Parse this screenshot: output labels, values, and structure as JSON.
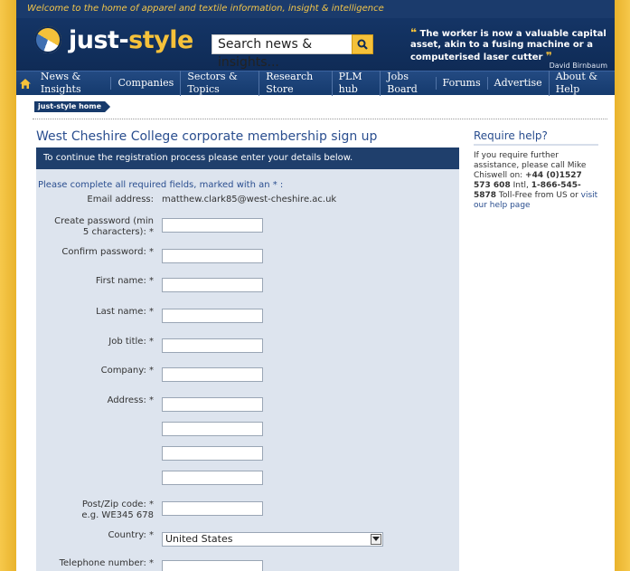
{
  "header": {
    "welcome": "Welcome to the home of apparel and textile information, insight & intelligence",
    "logo_text_main": "just-",
    "logo_text_accent": "style",
    "search_placeholder": "Search news & insights...",
    "quote_open": "❝",
    "quote_close": "❞",
    "quote_text": "The worker is now a valuable capital asset, akin to a fusing machine or a computerised laser cutter",
    "quote_author": "David Birnbaum"
  },
  "nav": {
    "home_icon": "home-icon",
    "items": [
      "News & Insights",
      "Companies",
      "Sectors & Topics",
      "Research Store",
      "PLM hub",
      "Jobs Board",
      "Forums",
      "Advertise",
      "About & Help"
    ]
  },
  "breadcrumb": "just-style home",
  "form": {
    "title": "West Cheshire College corporate membership sign up",
    "banner": "To continue the registration process please enter your details below.",
    "required_note": "Please complete all required fields, marked with an * :",
    "email_label": "Email address:",
    "email_value": "matthew.clark85@west-cheshire.ac.uk",
    "password_label_1": "Create password (min",
    "password_label_2": "5 characters): *",
    "confirm_label": "Confirm password: *",
    "first_name_label": "First name: *",
    "last_name_label": "Last name: *",
    "job_title_label": "Job title: *",
    "company_label": "Company: *",
    "address_label": "Address: *",
    "postcode_label_1": "Post/Zip code: *",
    "postcode_label_2": "e.g. WE345 678",
    "country_label": "Country: *",
    "country_value": "United States",
    "telephone_label": "Telephone number: *"
  },
  "help": {
    "title": "Require help?",
    "text_1": "If you require further assistance, please call Mike Chiswell on: ",
    "phone_uk": "+44 (0)1527 573 608",
    "text_2": " Intl, ",
    "phone_us": "1-866-545-5878",
    "text_3": " Toll-Free from US or ",
    "link": "visit our help page"
  },
  "colors": {
    "brand_navy": "#16386b",
    "brand_yellow": "#f5c13a",
    "link_blue": "#2a4e8f"
  }
}
